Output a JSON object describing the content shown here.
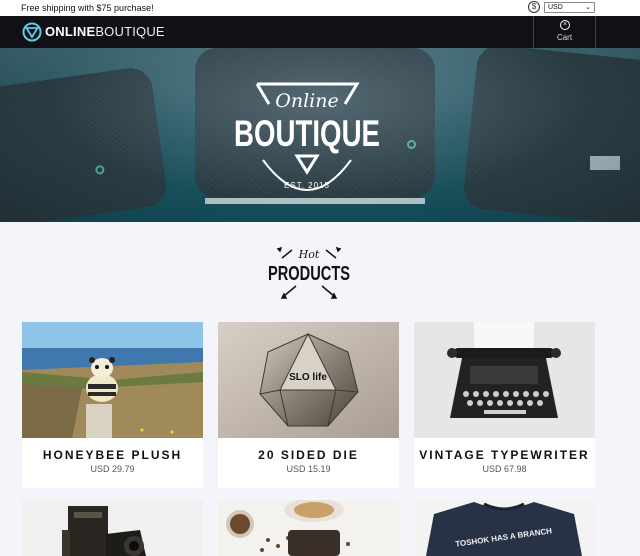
{
  "promo": {
    "text": "Free shipping with $75 purchase!"
  },
  "currency": {
    "icon": "dollar-circle-icon",
    "selected": "USD"
  },
  "navbar": {
    "logo_bold": "ONLINE",
    "logo_thin": "BOUTIQUE",
    "cart_label": "Cart",
    "cart_icon": "cart-icon"
  },
  "hero": {
    "emblem_script": "Online",
    "emblem_title": "BOUTIQUE",
    "emblem_est": "EST. 2015"
  },
  "section": {
    "hot_script": "Hot",
    "hot_title": "PRODUCTS"
  },
  "products": [
    {
      "name": "HONEYBEE PLUSH",
      "price": "USD 29.79"
    },
    {
      "name": "20 SIDED DIE",
      "price": "USD 15.19"
    },
    {
      "name": "VINTAGE TYPEWRITER",
      "price": "USD 67.98"
    },
    {
      "name": "",
      "price": ""
    },
    {
      "name": "",
      "price": ""
    },
    {
      "name": "",
      "price": ""
    }
  ],
  "image_text": {
    "die_label": "SLO life",
    "shirt_text": "TOSHOK HAS A BRANCH"
  },
  "colors": {
    "navbar": "#111014",
    "accent": "#5ecfe4",
    "background": "#f4f4fb"
  }
}
